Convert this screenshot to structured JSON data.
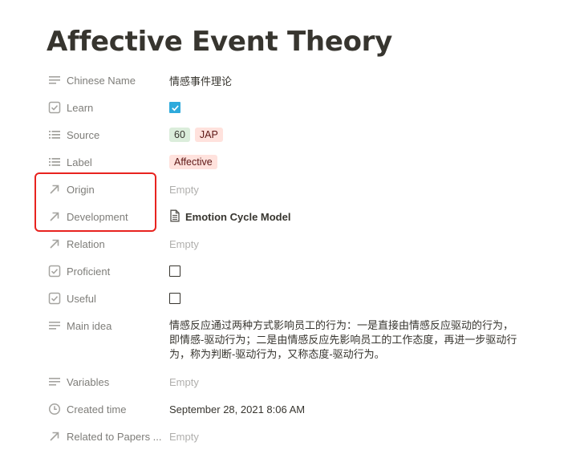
{
  "page": {
    "title": "Affective Event Theory"
  },
  "properties": [
    {
      "name": "Chinese Name",
      "icon": "text-lines-icon",
      "type": "text",
      "value": "情感事件理论"
    },
    {
      "name": "Learn",
      "icon": "checkbox-property-icon",
      "type": "checkbox",
      "checked": true
    },
    {
      "name": "Source",
      "icon": "list-icon",
      "type": "multi-select",
      "tags": [
        {
          "label": "60",
          "color": "#dbeddb"
        },
        {
          "label": "JAP",
          "color": "#ffe2dd"
        }
      ]
    },
    {
      "name": "Label",
      "icon": "list-icon",
      "type": "multi-select",
      "tags": [
        {
          "label": "Affective",
          "color": "#ffe2dd"
        }
      ]
    },
    {
      "name": "Origin",
      "icon": "relation-arrow-icon",
      "type": "relation",
      "empty_text": "Empty"
    },
    {
      "name": "Development",
      "icon": "relation-arrow-icon",
      "type": "relation",
      "value": "Emotion Cycle Model",
      "value_icon": "document-icon"
    },
    {
      "name": "Relation",
      "icon": "relation-arrow-icon",
      "type": "relation",
      "empty_text": "Empty"
    },
    {
      "name": "Proficient",
      "icon": "checkbox-property-icon",
      "type": "checkbox",
      "checked": false
    },
    {
      "name": "Useful",
      "icon": "checkbox-property-icon",
      "type": "checkbox",
      "checked": false
    },
    {
      "name": "Main idea",
      "icon": "text-lines-icon",
      "type": "text",
      "value": "情感反应通过两种方式影响员工的行为：一是直接由情感反应驱动的行为，即情感-驱动行为；二是由情感反应先影响员工的工作态度，再进一步驱动行为，称为判断-驱动行为，又称态度-驱动行为。"
    },
    {
      "name": "Variables",
      "icon": "text-lines-icon",
      "type": "text",
      "empty_text": "Empty"
    },
    {
      "name": "Created time",
      "icon": "clock-icon",
      "type": "created_time",
      "value": "September 28, 2021 8:06 AM"
    },
    {
      "name": "Related to Papers ...",
      "icon": "relation-arrow-icon",
      "type": "relation",
      "empty_text": "Empty"
    }
  ],
  "colors": {
    "text": "#37352f",
    "checkbox_checked": "#2eaadc",
    "highlight_annotation": "#e8231f"
  }
}
